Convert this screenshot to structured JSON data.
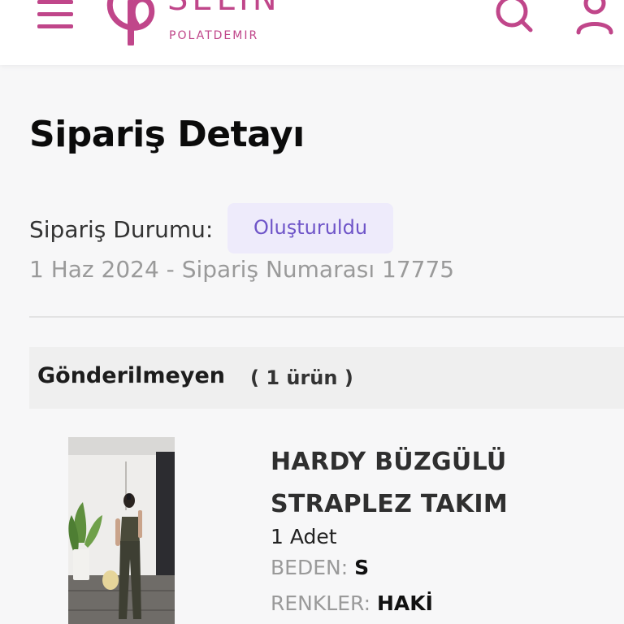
{
  "header": {
    "brand_name": "SELIN",
    "brand_sub": "POLATDEMIR",
    "icons": [
      "menu-icon",
      "logo-icon",
      "search-icon",
      "user-icon"
    ],
    "accent_color": "#c0468a"
  },
  "page": {
    "title": "Sipariş Detayı",
    "status_label": "Sipariş Durumu:",
    "status_value": "Oluşturuldu",
    "status_color": "#6e54c8",
    "order_meta": "1 Haz 2024 - Sipariş Numarası 17775"
  },
  "section": {
    "title": "Gönderilmeyen",
    "count": "( 1 ürün )"
  },
  "product": {
    "name": "HARDY BÜZGÜLÜ STRAPLEZ TAKIM",
    "quantity": "1 Adet",
    "size_label": "BEDEN:",
    "size_value": "S",
    "color_label": "RENKLER:",
    "color_value": "HAKİ"
  }
}
